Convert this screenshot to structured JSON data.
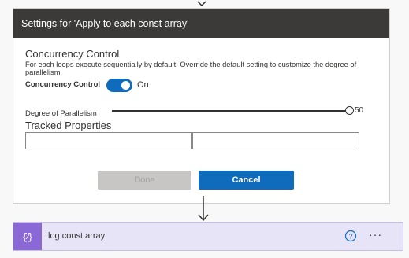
{
  "settings": {
    "header_title": "Settings for 'Apply to each const array'",
    "section_title": "Concurrency Control",
    "description": "For each loops execute sequentially by default. Override the default setting to customize the degree of parallelism.",
    "concurrency_label": "Concurrency Control",
    "toggle_state": "On",
    "toggle_on": true,
    "dop_label": "Degree of Parallelism",
    "dop_value": "50",
    "dop_fraction": 1.0,
    "tracked_title": "Tracked Properties",
    "tracked_key_value": "",
    "tracked_val_value": "",
    "done_label": "Done",
    "cancel_label": "Cancel"
  },
  "action": {
    "title": "log const array",
    "more_label": "···"
  },
  "colors": {
    "header_bg": "#3b3a39",
    "accent": "#0f6cbd",
    "action_icon_bg": "#8a68d6",
    "action_card_bg": "#e8e4f7"
  },
  "icons": [
    "arrow-down-icon",
    "code-braces-icon",
    "help-circle-icon",
    "more-icon"
  ]
}
